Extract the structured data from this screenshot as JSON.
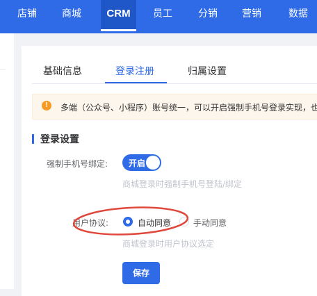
{
  "topnav": {
    "items": [
      "店铺",
      "商城",
      "CRM",
      "员工",
      "分销",
      "营销",
      "数据"
    ],
    "active_index": 2,
    "background": "#2f6be6",
    "active_background": "#1f56c8"
  },
  "tabs": [
    {
      "label": "基础信息",
      "active": false
    },
    {
      "label": "登录注册",
      "active": true
    },
    {
      "label": "归属设置",
      "active": false
    }
  ],
  "notice": {
    "icon": "warning-icon",
    "text": "多端（公众号、小程序）账号统一，可以开启强制手机号登录实现，也"
  },
  "section": {
    "title": "登录设置"
  },
  "phone_binding": {
    "label": "强制手机号绑定:",
    "switch_text": "开启",
    "switch_on": true,
    "hint": "商城登录时强制手机号登陆/绑定"
  },
  "user_agreement": {
    "label": "用户协议:",
    "options": [
      {
        "label": "自动同意",
        "checked": true
      },
      {
        "label": "手动同意",
        "checked": false
      }
    ],
    "hint": "商城登录时用户协议选定"
  },
  "save_label": "保存",
  "colors": {
    "accent": "#2f6be6",
    "annotation": "#e0483b",
    "warning": "#f59a23"
  }
}
